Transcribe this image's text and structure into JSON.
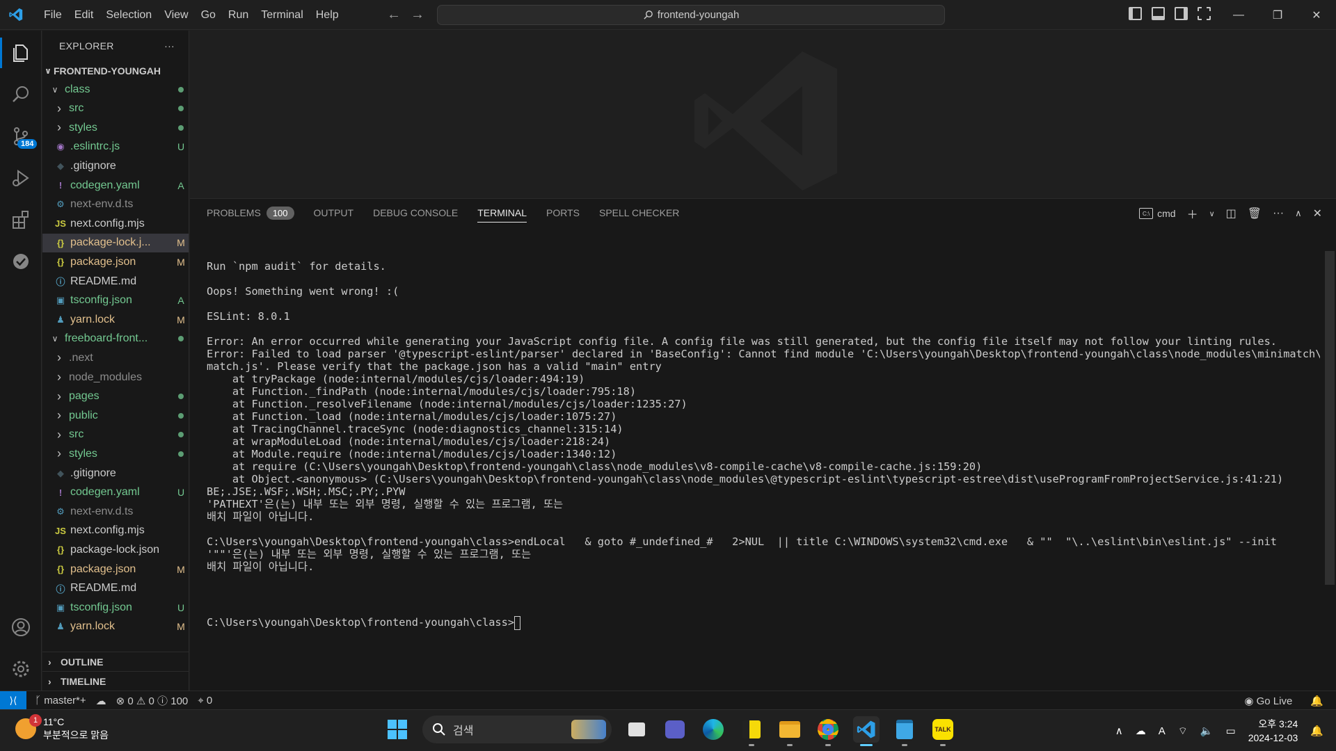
{
  "menu": [
    "File",
    "Edit",
    "Selection",
    "View",
    "Go",
    "Run",
    "Terminal",
    "Help"
  ],
  "command_center": "frontend-youngah",
  "accent_color": "#0078d4",
  "activity": {
    "source_control_badge": "184"
  },
  "explorer": {
    "title": "EXPLORER",
    "more": "···",
    "root": "FRONTEND-YOUNGAH",
    "rows": [
      {
        "name": "class",
        "type": "folder-open",
        "indent": 1,
        "status": "dot",
        "color": "green"
      },
      {
        "name": "src",
        "type": "folder",
        "indent": 2,
        "status": "dot",
        "color": "green"
      },
      {
        "name": "styles",
        "type": "folder",
        "indent": 2,
        "status": "dot",
        "color": "green"
      },
      {
        "name": ".eslintrc.js",
        "type": "eslint",
        "indent": 2,
        "status": "U",
        "color": "green"
      },
      {
        "name": ".gitignore",
        "type": "git",
        "indent": 2,
        "status": "",
        "color": "plain"
      },
      {
        "name": "codegen.yaml",
        "type": "yaml",
        "indent": 2,
        "status": "A",
        "color": "green"
      },
      {
        "name": "next-env.d.ts",
        "type": "ts-def",
        "indent": 2,
        "status": "",
        "color": "grey"
      },
      {
        "name": "next.config.mjs",
        "type": "js",
        "indent": 2,
        "status": "",
        "color": "plain"
      },
      {
        "name": "package-lock.j...",
        "type": "json",
        "indent": 2,
        "status": "M",
        "color": "orange",
        "selected": true
      },
      {
        "name": "package.json",
        "type": "json",
        "indent": 2,
        "status": "M",
        "color": "orange"
      },
      {
        "name": "README.md",
        "type": "info",
        "indent": 2,
        "status": "",
        "color": "plain"
      },
      {
        "name": "tsconfig.json",
        "type": "tsconfig",
        "indent": 2,
        "status": "A",
        "color": "green"
      },
      {
        "name": "yarn.lock",
        "type": "yarn",
        "indent": 2,
        "status": "M",
        "color": "orange"
      },
      {
        "name": "freeboard-front...",
        "type": "folder-open",
        "indent": 1,
        "status": "dot",
        "color": "green"
      },
      {
        "name": ".next",
        "type": "folder",
        "indent": 2,
        "status": "",
        "color": "grey"
      },
      {
        "name": "node_modules",
        "type": "folder",
        "indent": 2,
        "status": "",
        "color": "grey"
      },
      {
        "name": "pages",
        "type": "folder",
        "indent": 2,
        "status": "dot",
        "color": "green"
      },
      {
        "name": "public",
        "type": "folder",
        "indent": 2,
        "status": "dot",
        "color": "green"
      },
      {
        "name": "src",
        "type": "folder",
        "indent": 2,
        "status": "dot",
        "color": "green"
      },
      {
        "name": "styles",
        "type": "folder",
        "indent": 2,
        "status": "dot",
        "color": "green"
      },
      {
        "name": ".gitignore",
        "type": "git",
        "indent": 2,
        "status": "",
        "color": "plain"
      },
      {
        "name": "codegen.yaml",
        "type": "yaml",
        "indent": 2,
        "status": "U",
        "color": "green"
      },
      {
        "name": "next-env.d.ts",
        "type": "ts-def",
        "indent": 2,
        "status": "",
        "color": "grey"
      },
      {
        "name": "next.config.mjs",
        "type": "js",
        "indent": 2,
        "status": "",
        "color": "plain"
      },
      {
        "name": "package-lock.json",
        "type": "json",
        "indent": 2,
        "status": "",
        "color": "plain"
      },
      {
        "name": "package.json",
        "type": "json",
        "indent": 2,
        "status": "M",
        "color": "orange"
      },
      {
        "name": "README.md",
        "type": "info",
        "indent": 2,
        "status": "",
        "color": "plain"
      },
      {
        "name": "tsconfig.json",
        "type": "tsconfig",
        "indent": 2,
        "status": "U",
        "color": "green"
      },
      {
        "name": "yarn.lock",
        "type": "yarn",
        "indent": 2,
        "status": "M",
        "color": "orange"
      }
    ],
    "outline": "OUTLINE",
    "timeline": "TIMELINE"
  },
  "panel": {
    "tabs": [
      {
        "label": "PROBLEMS",
        "count": "100"
      },
      {
        "label": "OUTPUT"
      },
      {
        "label": "DEBUG CONSOLE"
      },
      {
        "label": "TERMINAL",
        "active": true
      },
      {
        "label": "PORTS"
      },
      {
        "label": "SPELL CHECKER"
      }
    ],
    "shell": "cmd"
  },
  "terminal_lines": [
    "Run `npm audit` for details.",
    "",
    "Oops! Something went wrong! :(",
    "",
    "ESLint: 8.0.1",
    "",
    "Error: An error occurred while generating your JavaScript config file. A config file was still generated, but the config file itself may not follow your linting rules.",
    "Error: Failed to load parser '@typescript-eslint/parser' declared in 'BaseConfig': Cannot find module 'C:\\Users\\youngah\\Desktop\\frontend-youngah\\class\\node_modules\\minimatch\\mini",
    "match.js'. Please verify that the package.json has a valid \"main\" entry",
    "    at tryPackage (node:internal/modules/cjs/loader:494:19)",
    "    at Function._findPath (node:internal/modules/cjs/loader:795:18)",
    "    at Function._resolveFilename (node:internal/modules/cjs/loader:1235:27)",
    "    at Function._load (node:internal/modules/cjs/loader:1075:27)",
    "    at TracingChannel.traceSync (node:diagnostics_channel:315:14)",
    "    at wrapModuleLoad (node:internal/modules/cjs/loader:218:24)",
    "    at Module.require (node:internal/modules/cjs/loader:1340:12)",
    "    at require (C:\\Users\\youngah\\Desktop\\frontend-youngah\\class\\node_modules\\v8-compile-cache\\v8-compile-cache.js:159:20)",
    "    at Object.<anonymous> (C:\\Users\\youngah\\Desktop\\frontend-youngah\\class\\node_modules\\@typescript-eslint\\typescript-estree\\dist\\useProgramFromProjectService.js:41:21)",
    "BE;.JSE;.WSF;.WSH;.MSC;.PY;.PYW",
    "'PATHEXT'은(는) 내부 또는 외부 명령, 실행할 수 있는 프로그램, 또는",
    "배치 파일이 아닙니다.",
    "",
    "C:\\Users\\youngah\\Desktop\\frontend-youngah\\class>endLocal   & goto #_undefined_#   2>NUL  || title C:\\WINDOWS\\system32\\cmd.exe   & \"\"  \"\\..\\eslint\\bin\\eslint.js\" --init",
    "'\"\"'은(는) 내부 또는 외부 명령, 실행할 수 있는 프로그램, 또는",
    "배치 파일이 아닙니다.",
    ""
  ],
  "terminal_prompt": "C:\\Users\\youngah\\Desktop\\frontend-youngah\\class>",
  "status": {
    "branch": "master*+",
    "errors": "0",
    "warnings": "0",
    "infos": "100",
    "ports": "0",
    "go_live": "Go Live"
  },
  "taskbar": {
    "weather_temp": "11°C",
    "weather_desc": "부분적으로 맑음",
    "weather_badge": "1",
    "search_placeholder": "검색",
    "time": "오후 3:24",
    "date": "2024-12-03",
    "ime": "A"
  }
}
